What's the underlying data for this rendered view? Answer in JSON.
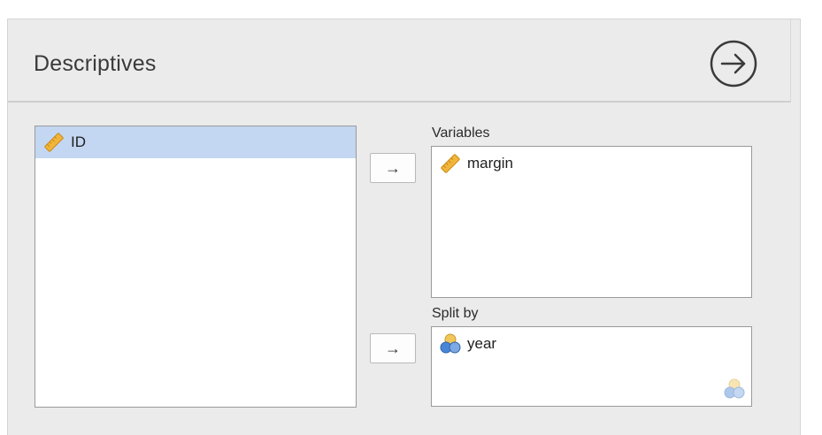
{
  "header": {
    "title": "Descriptives"
  },
  "source_list": {
    "items": [
      {
        "label": "ID",
        "icon": "ruler-icon",
        "selected": true
      }
    ]
  },
  "variables": {
    "label": "Variables",
    "items": [
      {
        "label": "margin",
        "icon": "ruler-icon"
      }
    ]
  },
  "split_by": {
    "label": "Split by",
    "items": [
      {
        "label": "year",
        "icon": "nominal-circles-icon"
      }
    ]
  },
  "buttons": {
    "move_arrow": "→"
  },
  "colors": {
    "panel_bg": "#ebebeb",
    "selection": "#c3d7f2",
    "ruler": "#f2b53b",
    "nominal_blue": "#4a86d8",
    "nominal_yellow": "#f1c75a"
  }
}
